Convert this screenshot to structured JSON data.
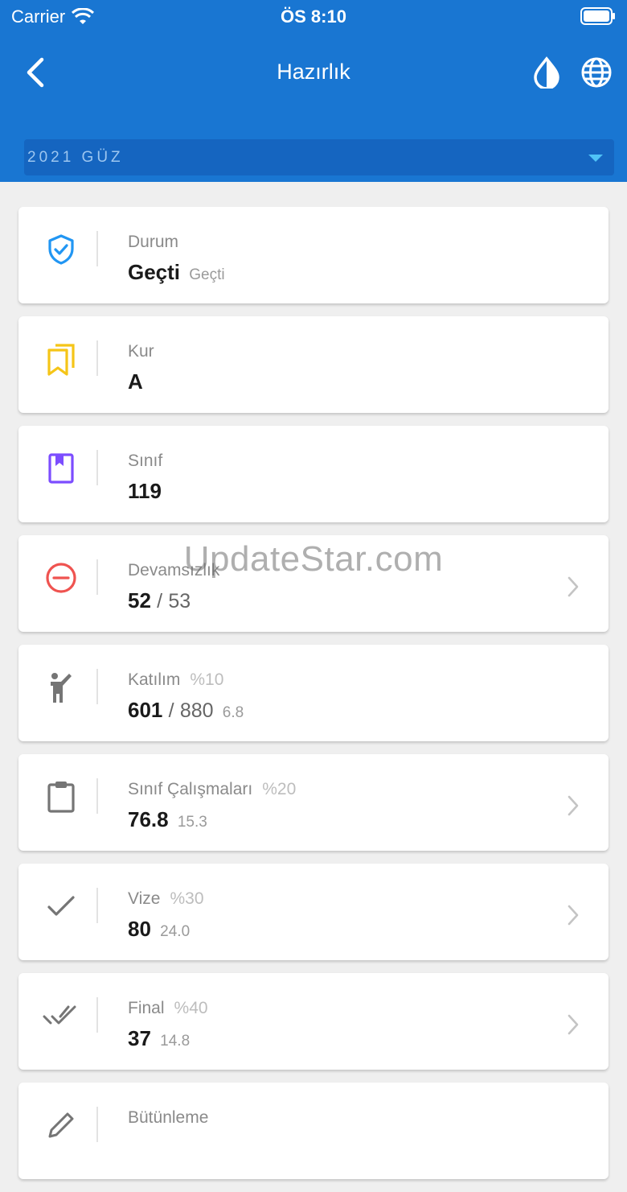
{
  "status_bar": {
    "carrier": "Carrier",
    "time": "ÖS 8:10"
  },
  "nav": {
    "title": "Hazırlık"
  },
  "semester": {
    "selected": "2021 GÜZ"
  },
  "colors": {
    "header": "#1976d2",
    "status_pass": "#2196f3",
    "level": "#f5c518",
    "class": "#7c4dff",
    "absence": "#ef5350",
    "neutral_icon": "#757575"
  },
  "cards": [
    {
      "label": "Durum",
      "value": "Geçti",
      "small": "Geçti",
      "icon": "shield-check-icon"
    },
    {
      "label": "Kur",
      "value": "A",
      "icon": "bookmarks-icon"
    },
    {
      "label": "Sınıf",
      "value": "119",
      "icon": "book-icon"
    },
    {
      "label": "Devamsızlık",
      "value": "52",
      "sep": "/",
      "secondary": "53",
      "icon": "minus-circle-icon"
    },
    {
      "label": "Katılım",
      "pct": "%10",
      "value": "601",
      "sep": "/",
      "secondary": "880",
      "small": "6.8",
      "icon": "person-raise-hand-icon"
    },
    {
      "label": "Sınıf Çalışmaları",
      "pct": "%20",
      "value": "76.8",
      "small": "15.3",
      "icon": "clipboard-icon"
    },
    {
      "label": "Vize",
      "pct": "%30",
      "value": "80",
      "small": "24.0",
      "icon": "check-icon"
    },
    {
      "label": "Final",
      "pct": "%40",
      "value": "37",
      "small": "14.8",
      "icon": "double-check-icon"
    },
    {
      "label": "Bütünleme",
      "icon": "pencil-icon"
    }
  ],
  "watermark": "UpdateStar.com"
}
